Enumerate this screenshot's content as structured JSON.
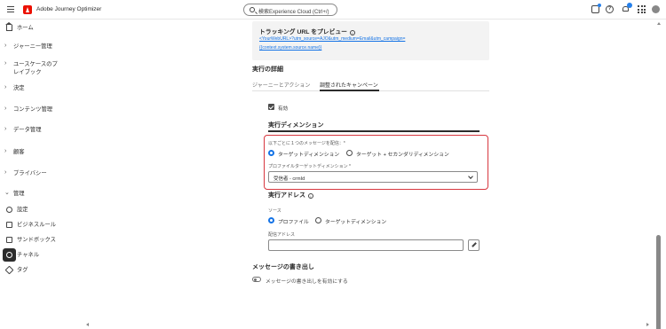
{
  "app": {
    "title": "Adobe Journey Optimizer"
  },
  "search": {
    "placeholder": "検索Experience Cloud (Ctrl+/)"
  },
  "sidebar": {
    "items": [
      {
        "label": "ホーム",
        "chevron": "",
        "icon": "home-icon"
      },
      {
        "label": "ジャーニー管理",
        "chevron": "›",
        "icon": ""
      },
      {
        "label": "ユースケースのプレイブック",
        "chevron": "›",
        "icon": ""
      },
      {
        "label": "決定",
        "chevron": "›",
        "icon": ""
      },
      {
        "label": "コンテンツ管理",
        "chevron": "›",
        "icon": ""
      },
      {
        "label": "データ管理",
        "chevron": "›",
        "icon": ""
      },
      {
        "label": "顧客",
        "chevron": "›",
        "icon": ""
      },
      {
        "label": "プライバシー",
        "chevron": "›",
        "icon": ""
      },
      {
        "label": "管理",
        "chevron": "⌄",
        "icon": ""
      },
      {
        "label": "設定",
        "chevron": "",
        "icon": "gear-icon"
      },
      {
        "label": "ビジネスルール",
        "chevron": "",
        "icon": "rules-icon"
      },
      {
        "label": "サンドボックス",
        "chevron": "",
        "icon": "sandbox-icon"
      },
      {
        "label": "チャネル",
        "chevron": "",
        "icon": "channel-icon"
      },
      {
        "label": "タグ",
        "chevron": "",
        "icon": "tag-icon"
      }
    ]
  },
  "tracking": {
    "title": "トラッキング URL をプレビュー",
    "url_line1": "<YourWebURL>?utm_source=AJO&utm_medium=Email&utm_campaign=",
    "url_line2": "{{context.system.source.name}}"
  },
  "execution": {
    "heading": "実行の詳細",
    "tabs": [
      "ジャーニーとアクション",
      "調整されたキャンペーン"
    ],
    "enabled_label": "有効",
    "dimension_heading": "実行ディメンション",
    "per_label": "以下ごとに１つのメッセージを配信：",
    "required_mark": "*",
    "radio1": "ターゲットディメンション",
    "radio2": "ターゲット + セカンダリディメンション",
    "profile_label": "プロファイルターゲットディメンション",
    "profile_value": "受信者 - crmId"
  },
  "address": {
    "heading": "実行アドレス",
    "source_label": "ソース",
    "radio_profile": "プロファイル",
    "radio_target": "ターゲットディメンション",
    "delivery_label": "配信アドレス",
    "delivery_value": ""
  },
  "rewrite": {
    "heading": "メッセージの書き出し",
    "toggle_label": "メッセージの書き出しを有効にする"
  },
  "colors": {
    "accent": "#1473e6",
    "highlight": "#d7373f",
    "brand": "#eb1000"
  }
}
